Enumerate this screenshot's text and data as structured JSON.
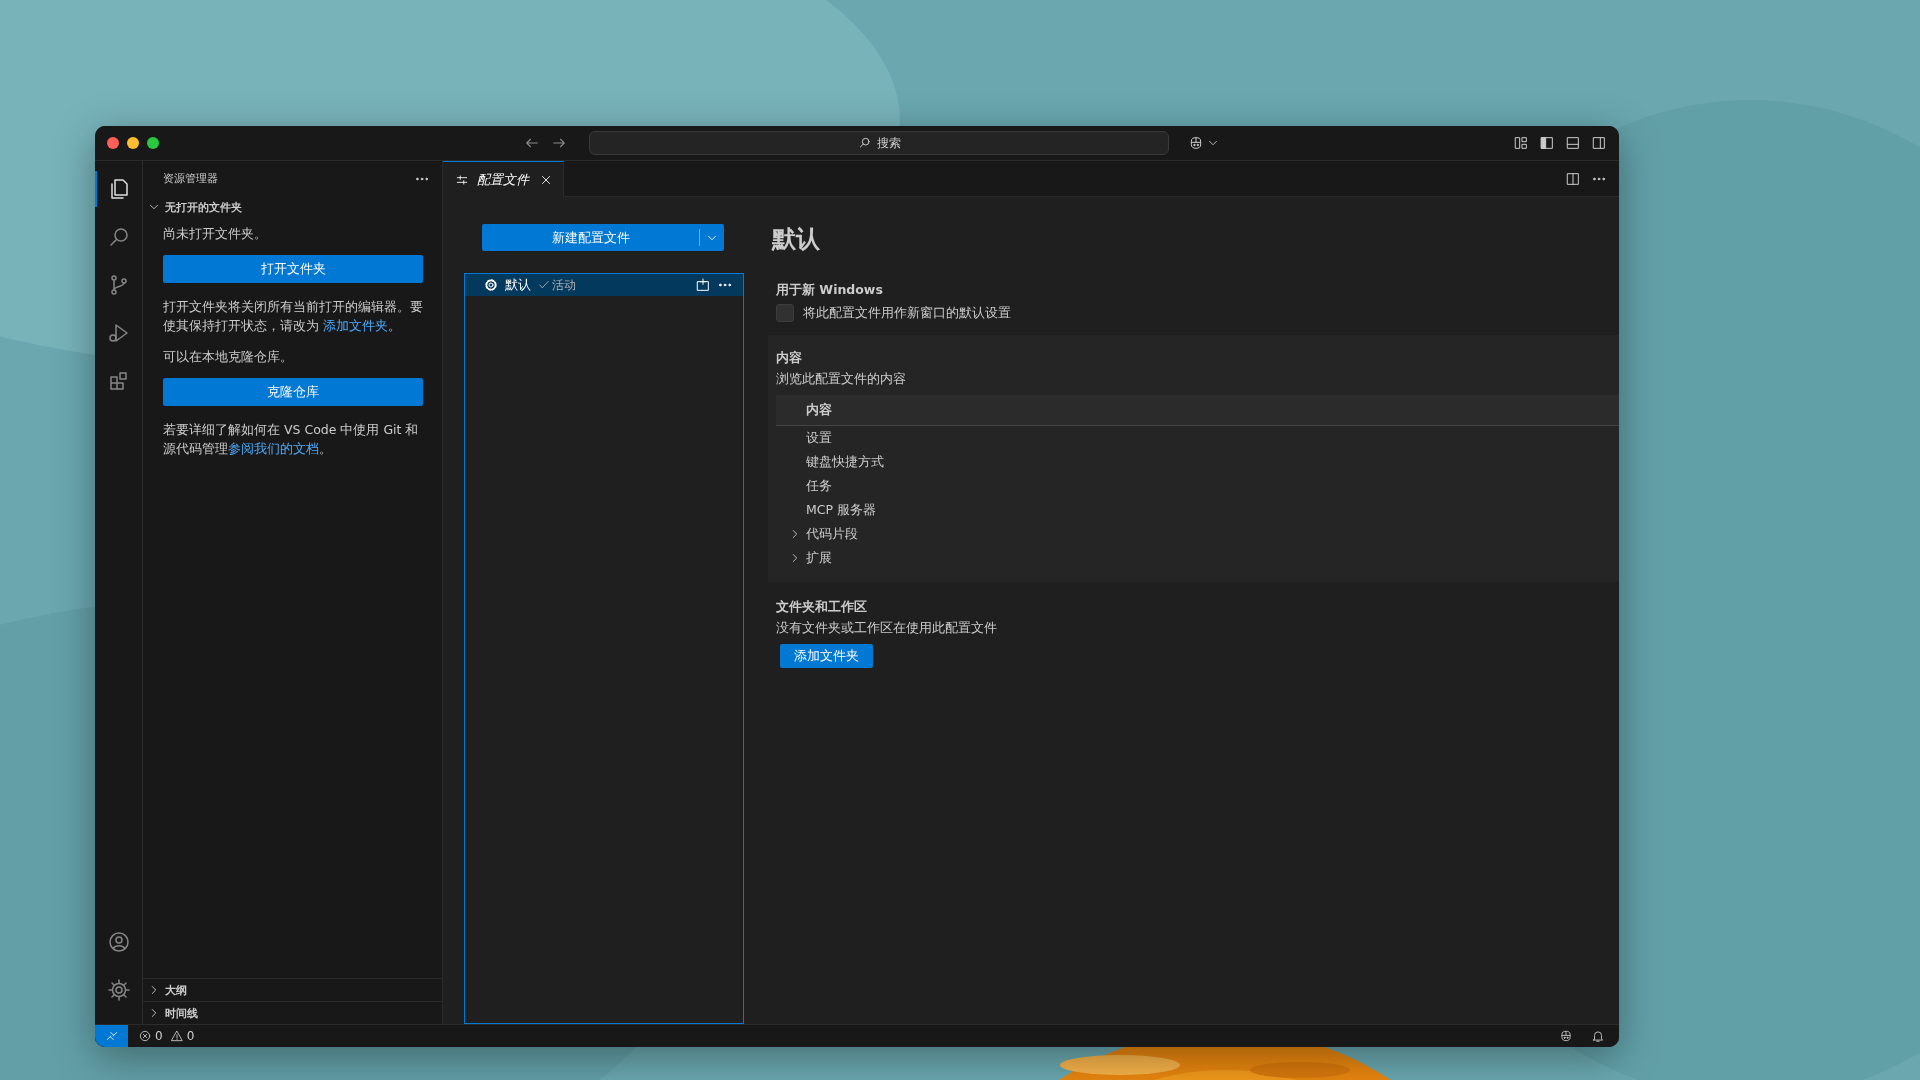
{
  "title_bar": {
    "search_placeholder": "搜索"
  },
  "activity_bar": {
    "top": [
      {
        "kind": "files",
        "selected": true
      },
      {
        "kind": "search",
        "selected": false
      },
      {
        "kind": "source-control",
        "selected": false
      },
      {
        "kind": "run",
        "selected": false
      },
      {
        "kind": "extensions",
        "selected": false
      }
    ],
    "bottom": [
      {
        "kind": "account"
      },
      {
        "kind": "manage"
      }
    ]
  },
  "sidebar": {
    "title": "资源管理器",
    "section": {
      "title": "无打开的文件夹",
      "expanded": true
    },
    "content": [
      {
        "kind": "text",
        "text": "尚未打开文件夹。"
      },
      {
        "kind": "button",
        "text": "打开文件夹"
      },
      {
        "kind": "text",
        "text": "打开文件夹将关闭所有当前打开的编辑器。要使其保持打开状态，请改为 ",
        "link": "添加文件夹",
        "after": "。"
      },
      {
        "kind": "text",
        "text": "可以在本地克隆仓库。"
      },
      {
        "kind": "button",
        "text": "克隆仓库"
      },
      {
        "kind": "text",
        "text": "若要详细了解如何在 VS Code 中使用 Git 和源代码管理",
        "link": "参阅我们的文档",
        "after": "。"
      }
    ],
    "panes": [
      {
        "title": "大纲",
        "expanded": false
      },
      {
        "title": "时间线",
        "expanded": false
      }
    ]
  },
  "tabs": [
    {
      "label": "配置文件",
      "selected": true
    }
  ],
  "profiles": {
    "new_button": "新建配置文件",
    "list": [
      {
        "name": "默认",
        "badge": "活动",
        "selected": true
      }
    ]
  },
  "detail": {
    "title": "默认",
    "new_windows": {
      "title": "用于新 Windows",
      "checkbox": {
        "label": "将此配置文件用作新窗口的默认设置",
        "checked": false
      }
    },
    "contents": {
      "title": "内容",
      "description": "浏览此配置文件的内容",
      "header": "内容",
      "rows": [
        {
          "label": "设置",
          "kind": "leaf"
        },
        {
          "label": "键盘快捷方式",
          "kind": "leaf"
        },
        {
          "label": "任务",
          "kind": "leaf"
        },
        {
          "label": "MCP 服务器",
          "kind": "leaf"
        },
        {
          "label": "代码片段",
          "kind": "group"
        },
        {
          "label": "扩展",
          "kind": "group"
        }
      ]
    },
    "folders": {
      "title": "文件夹和工作区",
      "description": "没有文件夹或工作区在使用此配置文件",
      "button": "添加文件夹"
    }
  },
  "status_bar": {
    "errors": "0",
    "warnings": "0"
  }
}
